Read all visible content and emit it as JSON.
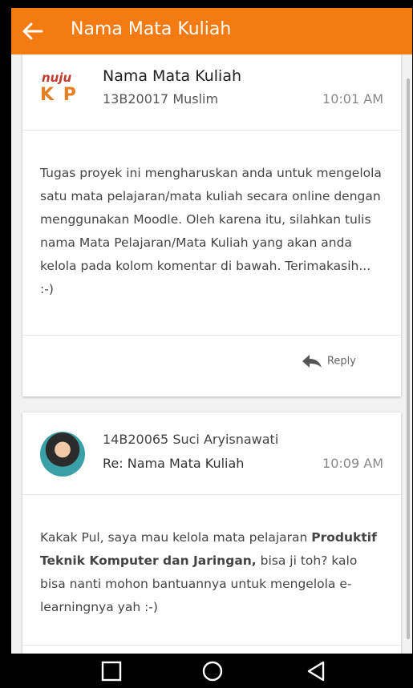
{
  "app_bar": {
    "title": "Nama Mata Kuliah",
    "color": "#f47a12"
  },
  "posts": [
    {
      "logo_text_top": "nuju",
      "logo_text_bottom": "K P",
      "title": "Nama Mata Kuliah",
      "author": "13B20017 Muslim",
      "time": "10:01 AM",
      "body": "Tugas proyek ini mengharuskan anda untuk mengelola satu mata pelajaran/mata kuliah secara online dengan menggunakan Moodle. Oleh karena itu, silahkan tulis nama Mata Pelajaran/Mata Kuliah yang akan anda kelola pada kolom komentar di bawah. Terimakasih... :-)",
      "reply_label": "Reply"
    },
    {
      "author": "14B20065 Suci Aryisnawati",
      "subject": "Re: Nama Mata Kuliah",
      "time": "10:09 AM",
      "body_before": "Kakak Pul, saya mau kelola mata pelajaran ",
      "body_bold": "Produktif Teknik Komputer dan Jaringan,",
      "body_after": " bisa ji toh? kalo bisa nanti mohon bantuannya untuk mengelola e-learningnya yah :-)"
    }
  ],
  "icons": {
    "back": "arrow-left-icon",
    "reply": "reply-arrow-icon",
    "nav_recent": "square-icon",
    "nav_home": "circle-icon",
    "nav_back": "triangle-back-icon"
  }
}
